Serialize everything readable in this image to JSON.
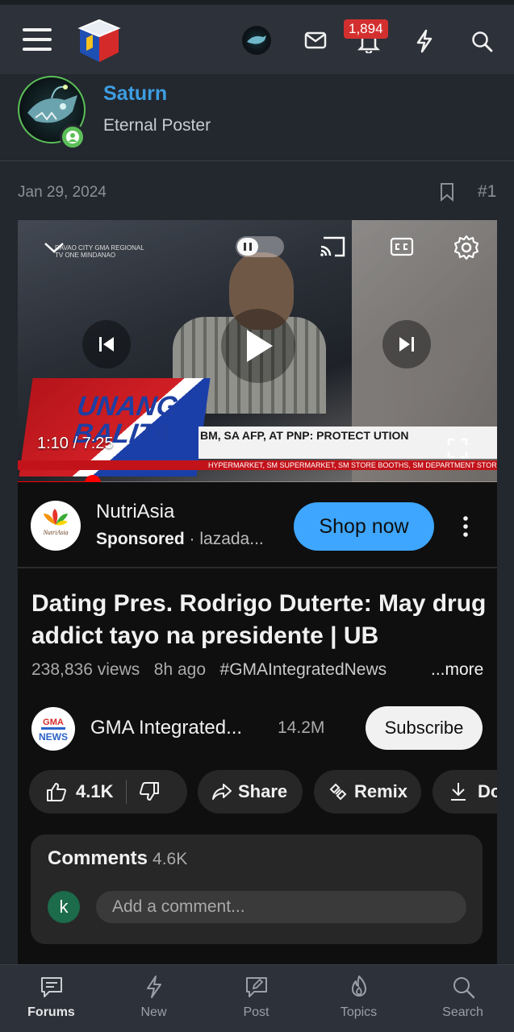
{
  "topbar": {
    "notification_count": "1,894",
    "icons": [
      "menu-icon",
      "site-logo",
      "user-avatar",
      "mail-icon",
      "bell-icon",
      "bolt-icon",
      "search-icon"
    ]
  },
  "post": {
    "username": "Saturn",
    "user_title": "Eternal Poster",
    "date": "Jan 29, 2024",
    "post_number": "#1"
  },
  "video": {
    "time": "1:10 / 7:25",
    "progress": 0.156,
    "overlay_brand": "UNANG BALITA",
    "ticker_text": "BM, SA AFP, AT PNP: PROTECT UTION",
    "ticker_strip": "HYPERMARKET, SM SUPERMARKET, SM STORE BOOTHS, SM DEPARTMENT STORE, SM A",
    "station": "DAVAO CITY GMA REGIONAL TV ONE MINDANAO"
  },
  "ad": {
    "advertiser": "NutriAsia",
    "sponsored": "Sponsored",
    "domain": " · lazada...",
    "cta": "Shop now"
  },
  "youtube": {
    "title": "Dating Pres. Rodrigo Duterte: May drug addict tayo na presidente | UB",
    "views": "238,836 views",
    "age": "8h ago",
    "hashtag": "#GMAIntegratedNews",
    "more": "...more",
    "channel": "GMA Integrated...",
    "subscribers": "14.2M",
    "subscribe": "Subscribe",
    "likes": "4.1K",
    "share": "Share",
    "remix": "Remix",
    "download": "Do",
    "comments_title": "Comments",
    "comments_count": "4.6K",
    "commenter_initial": "k",
    "comment_placeholder": "Add a comment..."
  },
  "bottom_nav": [
    {
      "label": "Forums",
      "icon": "forums-icon",
      "active": true
    },
    {
      "label": "New",
      "icon": "bolt-icon"
    },
    {
      "label": "Post",
      "icon": "post-icon"
    },
    {
      "label": "Topics",
      "icon": "fire-icon"
    },
    {
      "label": "Search",
      "icon": "search-icon"
    }
  ],
  "colors": {
    "accent_blue": "#3d9de0",
    "online_green": "#5cbf58",
    "badge_red": "#d32f2f",
    "youtube_red": "#ff0000",
    "shop_blue": "#3ea6ff"
  }
}
